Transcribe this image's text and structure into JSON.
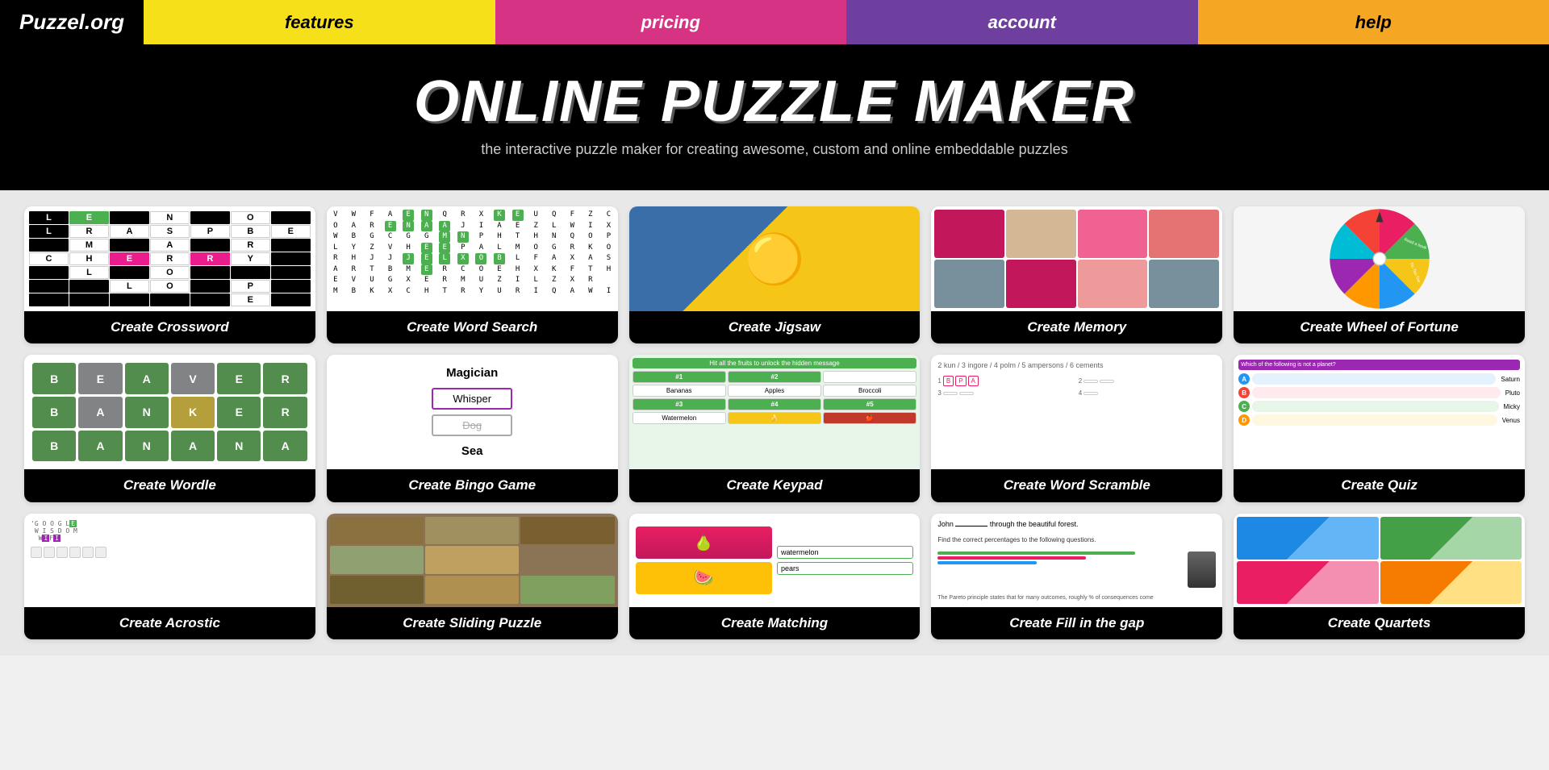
{
  "nav": {
    "logo": "Puzzel.org",
    "items": [
      {
        "label": "features",
        "class": "features"
      },
      {
        "label": "pricing",
        "class": "pricing"
      },
      {
        "label": "account",
        "class": "account"
      },
      {
        "label": "help",
        "class": "help"
      }
    ]
  },
  "hero": {
    "title": "ONLINE PUZZLE MAKER",
    "subtitle": "the interactive puzzle maker for creating awesome, custom and online embeddable puzzles"
  },
  "puzzles": [
    {
      "id": "crossword",
      "label": "Create Crossword"
    },
    {
      "id": "wordsearch",
      "label": "Create Word Search"
    },
    {
      "id": "jigsaw",
      "label": "Create Jigsaw"
    },
    {
      "id": "memory",
      "label": "Create Memory"
    },
    {
      "id": "wheeloffortune",
      "label": "Create Wheel of Fortune"
    },
    {
      "id": "wordle",
      "label": "Create Wordle"
    },
    {
      "id": "bingo",
      "label": "Create Bingo Game"
    },
    {
      "id": "keypad",
      "label": "Create Keypad"
    },
    {
      "id": "wordscramble",
      "label": "Create Word Scramble"
    },
    {
      "id": "quiz",
      "label": "Create Quiz"
    },
    {
      "id": "acrostic",
      "label": "Create Acrostic"
    },
    {
      "id": "sliding",
      "label": "Create Sliding Puzzle"
    },
    {
      "id": "matching",
      "label": "Create Matching"
    },
    {
      "id": "fillgap",
      "label": "Create Fill in the gap"
    },
    {
      "id": "quartets",
      "label": "Create Quartets"
    }
  ]
}
